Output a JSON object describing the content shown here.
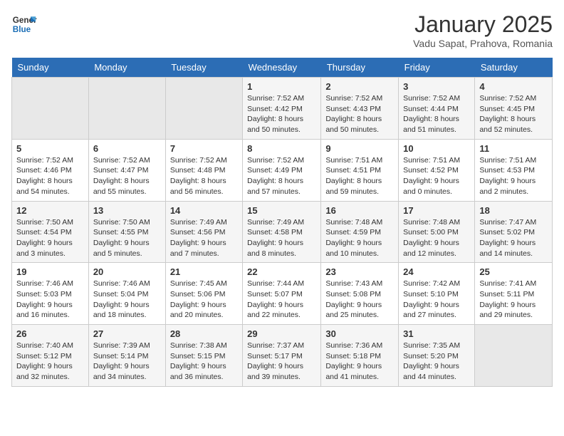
{
  "logo": {
    "line1": "General",
    "line2": "Blue"
  },
  "title": "January 2025",
  "subtitle": "Vadu Sapat, Prahova, Romania",
  "days_of_week": [
    "Sunday",
    "Monday",
    "Tuesday",
    "Wednesday",
    "Thursday",
    "Friday",
    "Saturday"
  ],
  "weeks": [
    [
      {
        "day": "",
        "info": ""
      },
      {
        "day": "",
        "info": ""
      },
      {
        "day": "",
        "info": ""
      },
      {
        "day": "1",
        "info": "Sunrise: 7:52 AM\nSunset: 4:42 PM\nDaylight: 8 hours\nand 50 minutes."
      },
      {
        "day": "2",
        "info": "Sunrise: 7:52 AM\nSunset: 4:43 PM\nDaylight: 8 hours\nand 50 minutes."
      },
      {
        "day": "3",
        "info": "Sunrise: 7:52 AM\nSunset: 4:44 PM\nDaylight: 8 hours\nand 51 minutes."
      },
      {
        "day": "4",
        "info": "Sunrise: 7:52 AM\nSunset: 4:45 PM\nDaylight: 8 hours\nand 52 minutes."
      }
    ],
    [
      {
        "day": "5",
        "info": "Sunrise: 7:52 AM\nSunset: 4:46 PM\nDaylight: 8 hours\nand 54 minutes."
      },
      {
        "day": "6",
        "info": "Sunrise: 7:52 AM\nSunset: 4:47 PM\nDaylight: 8 hours\nand 55 minutes."
      },
      {
        "day": "7",
        "info": "Sunrise: 7:52 AM\nSunset: 4:48 PM\nDaylight: 8 hours\nand 56 minutes."
      },
      {
        "day": "8",
        "info": "Sunrise: 7:52 AM\nSunset: 4:49 PM\nDaylight: 8 hours\nand 57 minutes."
      },
      {
        "day": "9",
        "info": "Sunrise: 7:51 AM\nSunset: 4:51 PM\nDaylight: 8 hours\nand 59 minutes."
      },
      {
        "day": "10",
        "info": "Sunrise: 7:51 AM\nSunset: 4:52 PM\nDaylight: 9 hours\nand 0 minutes."
      },
      {
        "day": "11",
        "info": "Sunrise: 7:51 AM\nSunset: 4:53 PM\nDaylight: 9 hours\nand 2 minutes."
      }
    ],
    [
      {
        "day": "12",
        "info": "Sunrise: 7:50 AM\nSunset: 4:54 PM\nDaylight: 9 hours\nand 3 minutes."
      },
      {
        "day": "13",
        "info": "Sunrise: 7:50 AM\nSunset: 4:55 PM\nDaylight: 9 hours\nand 5 minutes."
      },
      {
        "day": "14",
        "info": "Sunrise: 7:49 AM\nSunset: 4:56 PM\nDaylight: 9 hours\nand 7 minutes."
      },
      {
        "day": "15",
        "info": "Sunrise: 7:49 AM\nSunset: 4:58 PM\nDaylight: 9 hours\nand 8 minutes."
      },
      {
        "day": "16",
        "info": "Sunrise: 7:48 AM\nSunset: 4:59 PM\nDaylight: 9 hours\nand 10 minutes."
      },
      {
        "day": "17",
        "info": "Sunrise: 7:48 AM\nSunset: 5:00 PM\nDaylight: 9 hours\nand 12 minutes."
      },
      {
        "day": "18",
        "info": "Sunrise: 7:47 AM\nSunset: 5:02 PM\nDaylight: 9 hours\nand 14 minutes."
      }
    ],
    [
      {
        "day": "19",
        "info": "Sunrise: 7:46 AM\nSunset: 5:03 PM\nDaylight: 9 hours\nand 16 minutes."
      },
      {
        "day": "20",
        "info": "Sunrise: 7:46 AM\nSunset: 5:04 PM\nDaylight: 9 hours\nand 18 minutes."
      },
      {
        "day": "21",
        "info": "Sunrise: 7:45 AM\nSunset: 5:06 PM\nDaylight: 9 hours\nand 20 minutes."
      },
      {
        "day": "22",
        "info": "Sunrise: 7:44 AM\nSunset: 5:07 PM\nDaylight: 9 hours\nand 22 minutes."
      },
      {
        "day": "23",
        "info": "Sunrise: 7:43 AM\nSunset: 5:08 PM\nDaylight: 9 hours\nand 25 minutes."
      },
      {
        "day": "24",
        "info": "Sunrise: 7:42 AM\nSunset: 5:10 PM\nDaylight: 9 hours\nand 27 minutes."
      },
      {
        "day": "25",
        "info": "Sunrise: 7:41 AM\nSunset: 5:11 PM\nDaylight: 9 hours\nand 29 minutes."
      }
    ],
    [
      {
        "day": "26",
        "info": "Sunrise: 7:40 AM\nSunset: 5:12 PM\nDaylight: 9 hours\nand 32 minutes."
      },
      {
        "day": "27",
        "info": "Sunrise: 7:39 AM\nSunset: 5:14 PM\nDaylight: 9 hours\nand 34 minutes."
      },
      {
        "day": "28",
        "info": "Sunrise: 7:38 AM\nSunset: 5:15 PM\nDaylight: 9 hours\nand 36 minutes."
      },
      {
        "day": "29",
        "info": "Sunrise: 7:37 AM\nSunset: 5:17 PM\nDaylight: 9 hours\nand 39 minutes."
      },
      {
        "day": "30",
        "info": "Sunrise: 7:36 AM\nSunset: 5:18 PM\nDaylight: 9 hours\nand 41 minutes."
      },
      {
        "day": "31",
        "info": "Sunrise: 7:35 AM\nSunset: 5:20 PM\nDaylight: 9 hours\nand 44 minutes."
      },
      {
        "day": "",
        "info": ""
      }
    ]
  ]
}
